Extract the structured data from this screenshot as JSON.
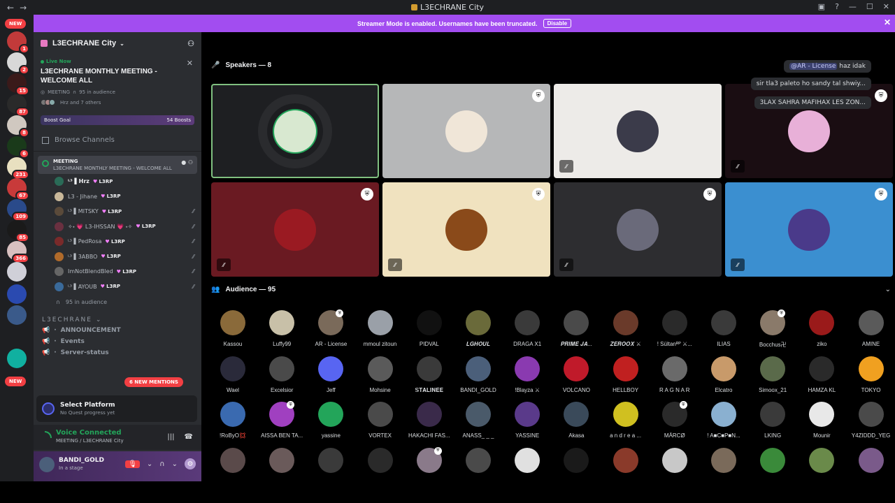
{
  "window": {
    "title": "L3ECHRANE City"
  },
  "banner": {
    "text": "Streamer Mode is enabled. Usernames have been truncated.",
    "disable_label": "Disable"
  },
  "rail": {
    "new_top": "NEW",
    "new_bottom": "NEW",
    "badges": [
      "1",
      "2",
      "15",
      "87",
      "8",
      "6",
      "231",
      "67",
      "109",
      "85",
      "366"
    ]
  },
  "sidebar": {
    "server_name": "L3ECHRANE City",
    "live_tag": "Live Now",
    "event_title": "L3ECHRANE MONTHLY MEETING - WELCOME ALL",
    "event_channel": "MEETING",
    "event_audience": "95 in audience",
    "event_people": "Hrz and 7 others",
    "boost_label": "Boost Goal",
    "boost_count": "54 Boosts",
    "browse": "Browse Channels",
    "meeting_name": "MEETING",
    "meeting_sub": "L3ECHRANE MONTHLY MEETING - WELCOME ALL",
    "speakers": [
      {
        "name": "ᴸ³ ▌Hrz",
        "tag": "L3RP",
        "muted": false,
        "bold": true,
        "color": "#2a6b57"
      },
      {
        "name": "L3 - Jihane",
        "tag": "L3RP",
        "muted": false,
        "bold": false,
        "color": "#c9b89a"
      },
      {
        "name": "ᴸ³ ▌MITSKY",
        "tag": "L3RP",
        "muted": true,
        "bold": false,
        "color": "#5a4a3a"
      },
      {
        "name": "✧˖ 💗 L3-IHSSAN 💗 ˖✧",
        "tag": "L3RP",
        "muted": true,
        "bold": false,
        "color": "#6a3040"
      },
      {
        "name": "ᴸ³ ▌PedRosa",
        "tag": "L3RP",
        "muted": true,
        "bold": false,
        "color": "#7a2a2a"
      },
      {
        "name": "ᴸ³ ▌3ABBO",
        "tag": "L3RP",
        "muted": true,
        "bold": false,
        "color": "#b06a2a"
      },
      {
        "name": "ImNotBlendBled",
        "tag": "L3RP",
        "muted": true,
        "bold": false,
        "color": "#666666"
      },
      {
        "name": "ᴸ³ ▌AYOUB",
        "tag": "L3RP",
        "muted": true,
        "bold": false,
        "color": "#3a6a9a"
      }
    ],
    "audience": "95 in audience",
    "category": "L3ECHRANE",
    "channels": [
      "ANNOUNCEMENT",
      "Events",
      "Server-status"
    ],
    "new_mentions": "6 NEW MENTIONS",
    "quest_title": "Select Platform",
    "quest_sub": "No Quest progress yet",
    "voice_status": "Voice Connected",
    "voice_channel": "MEETING / L3ECHRANE City",
    "user_name": "BANDI_GOLD",
    "user_status": "In a stage"
  },
  "stage": {
    "speakers_header": "Speakers — 8",
    "audience_header": "Audience — 95",
    "tiles": [
      {
        "bg": "#1e1f22",
        "av": "#d8e8d0",
        "shield": false,
        "muted": false,
        "active": true
      },
      {
        "bg": "#b6b7b8",
        "av": "#f0e6d8",
        "shield": true,
        "muted": false,
        "active": false
      },
      {
        "bg": "#edebe8",
        "av": "#3b3b4a",
        "shield": false,
        "muted": true,
        "active": false
      },
      {
        "bg": "#1a0d12",
        "av": "#e8b0d8",
        "shield": true,
        "muted": true,
        "active": false
      },
      {
        "bg": "#6a1a22",
        "av": "#9a1a22",
        "shield": true,
        "muted": true,
        "active": false
      },
      {
        "bg": "#f0e2bf",
        "av": "#8a4a1a",
        "shield": true,
        "muted": true,
        "active": false
      },
      {
        "bg": "#2d2d30",
        "av": "#6a6a7a",
        "shield": true,
        "muted": true,
        "active": false
      },
      {
        "bg": "#3b8fd0",
        "av": "#4a3a8a",
        "shield": true,
        "muted": true,
        "active": false
      }
    ],
    "chat": [
      {
        "mention": "@AR - License",
        "text": "haz idak"
      },
      {
        "mention": "",
        "text": "sir tla3 paleto ho sandy tal shwiy..."
      },
      {
        "mention": "",
        "text": "3LAX SAHRA MAFIHAX LES ZON..."
      }
    ],
    "audience": [
      {
        "name": "Kassou",
        "c": "#8a6a3a"
      },
      {
        "name": "Luffy99",
        "c": "#c8c0a8"
      },
      {
        "name": "AR - License",
        "c": "#7a6a5a",
        "mod": true
      },
      {
        "name": "mmoul zitoun",
        "c": "#9aa0a8"
      },
      {
        "name": "PIDVAL",
        "c": "#111111"
      },
      {
        "name": "𝑳𝑮𝑯𝑶𝑼𝑳",
        "c": "#6a6a3a"
      },
      {
        "name": "DRAGA X1",
        "c": "#3a3a3a"
      },
      {
        "name": "𝑷𝑹𝑰𝑴𝑬 𝑱𝑨...",
        "c": "#4a4a4a"
      },
      {
        "name": "𝒁𝑬𝑹𝑶𝑶𝑿 ⚔",
        "c": "#6a3a2a"
      },
      {
        "name": "! Sültanᴿᴾ ⚔...",
        "c": "#2a2a2a"
      },
      {
        "name": "ILIAS",
        "c": "#3a3a3a"
      },
      {
        "name": "Bocchus卍",
        "c": "#8a7a6a",
        "mod": true
      },
      {
        "name": "ziko",
        "c": "#9a1a1a"
      },
      {
        "name": "AMINE",
        "c": "#5a5a5a"
      },
      {
        "name": "Wael",
        "c": "#2a2a3a"
      },
      {
        "name": "Excelsior",
        "c": "#4a4a4a"
      },
      {
        "name": "Jeff",
        "c": "#5865f2"
      },
      {
        "name": "Mohsine",
        "c": "#5a5a5a"
      },
      {
        "name": "𝐒𝐓𝐀𝐋𝐈𝐍𝐄𝐄",
        "c": "#3a3a3a"
      },
      {
        "name": "BANDI_GOLD",
        "c": "#4b5f7a"
      },
      {
        "name": "!Blayza ⚔",
        "c": "#8a3ab0"
      },
      {
        "name": "VOLCANO",
        "c": "#c01a2a"
      },
      {
        "name": "HELLBOY",
        "c": "#c02020"
      },
      {
        "name": "R A G N A R",
        "c": "#6a6a6a"
      },
      {
        "name": "Elcatro",
        "c": "#c89a6a"
      },
      {
        "name": "Simoox_21",
        "c": "#5a6a4a"
      },
      {
        "name": "HAMZA KL",
        "c": "#2a2a2a"
      },
      {
        "name": "TOKYO",
        "c": "#f0a020"
      },
      {
        "name": "!RoByO💢",
        "c": "#3a6ab0"
      },
      {
        "name": "AISSA BEN TA...",
        "c": "#a040c0",
        "mod": true
      },
      {
        "name": "yassine",
        "c": "#23a55a"
      },
      {
        "name": "VORTEX",
        "c": "#4a4a4a"
      },
      {
        "name": "HAKACHI FAS...",
        "c": "#3a2a4a"
      },
      {
        "name": "ANASS_ _ _",
        "c": "#4a5a6a"
      },
      {
        "name": "YASSINE",
        "c": "#5a3a8a"
      },
      {
        "name": "Akasa",
        "c": "#3a4a5a"
      },
      {
        "name": "a n d r e a ...",
        "c": "#d0c020"
      },
      {
        "name": "MÃRCØ",
        "c": "#2a2a2a",
        "mod": true
      },
      {
        "name": "! A■C■P■N...",
        "c": "#8ab0d0"
      },
      {
        "name": "LKING",
        "c": "#3a3a3a"
      },
      {
        "name": "Mounir",
        "c": "#e8e8e8"
      },
      {
        "name": "Y4ZIDDD_YEG",
        "c": "#4a4a4a"
      },
      {
        "name": "",
        "c": "#5a4a4a"
      },
      {
        "name": "",
        "c": "#6a5a5a"
      },
      {
        "name": "",
        "c": "#3a3a3a"
      },
      {
        "name": "",
        "c": "#2a2a2a"
      },
      {
        "name": "",
        "c": "#8a7a8a",
        "mod": true
      },
      {
        "name": "",
        "c": "#4a4a4a"
      },
      {
        "name": "",
        "c": "#e0e0e0"
      },
      {
        "name": "",
        "c": "#1a1a1a"
      },
      {
        "name": "",
        "c": "#8a3a2a"
      },
      {
        "name": "",
        "c": "#c8c8c8"
      },
      {
        "name": "",
        "c": "#7a6a5a"
      },
      {
        "name": "",
        "c": "#3a8a3a"
      },
      {
        "name": "",
        "c": "#6a8a4a"
      },
      {
        "name": "",
        "c": "#7a5a8a"
      }
    ]
  }
}
